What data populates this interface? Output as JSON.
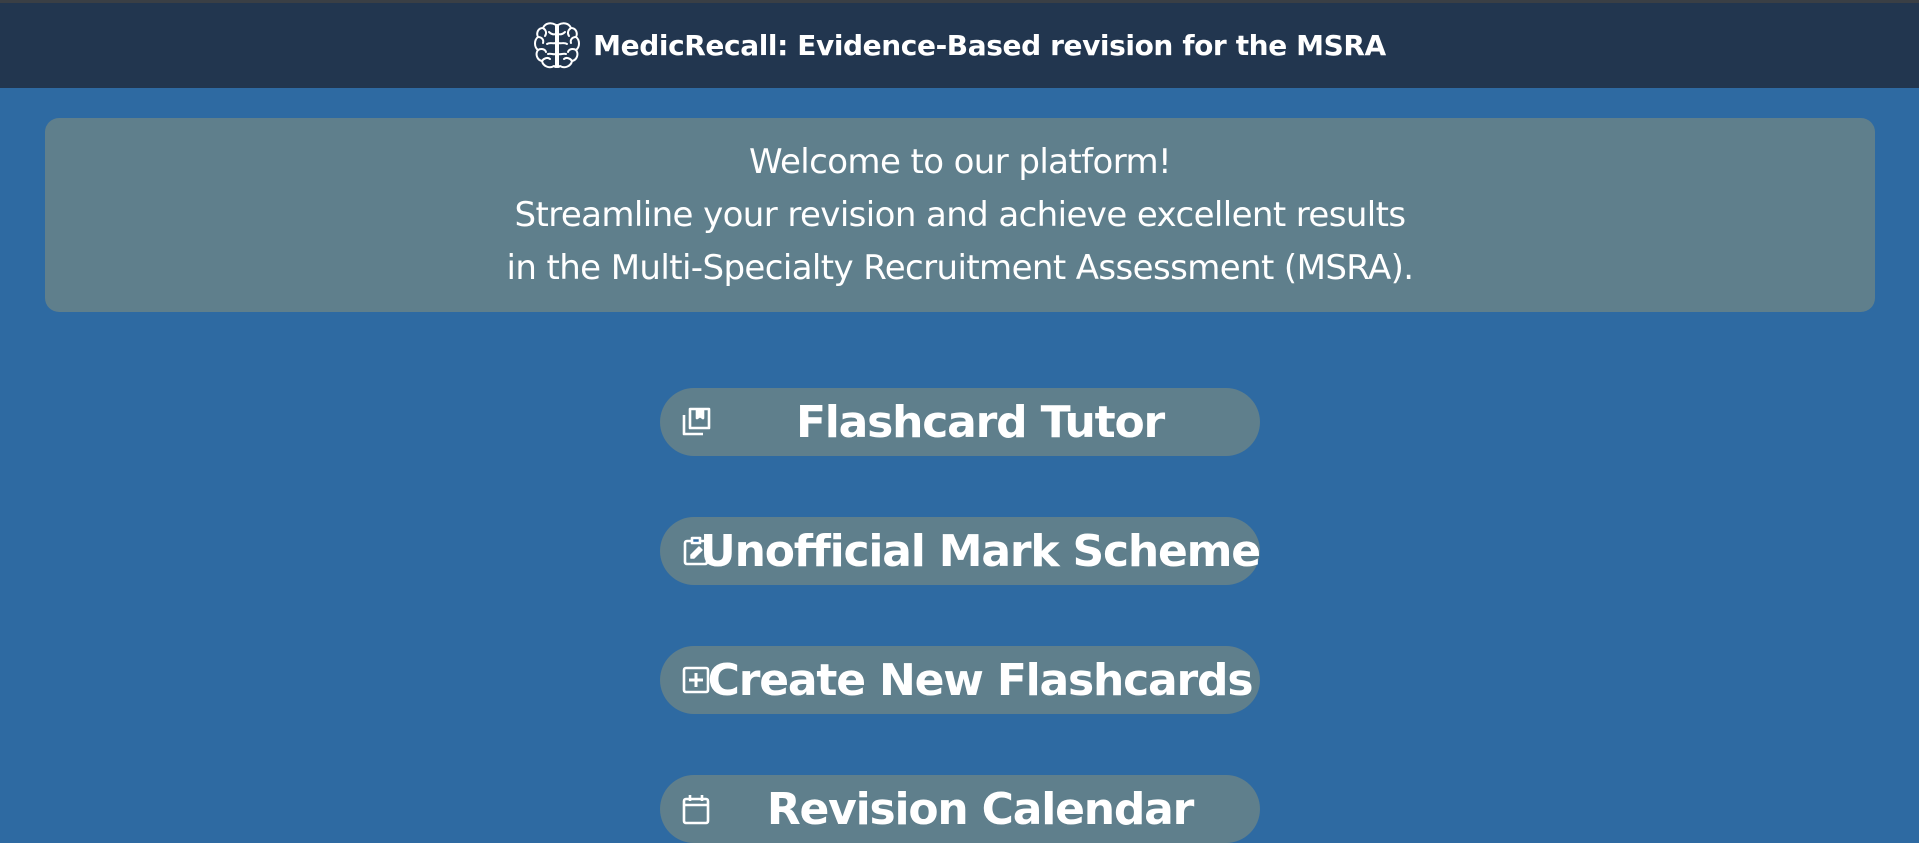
{
  "header": {
    "logo_icon": "brain-icon",
    "title": "MedicRecall: Evidence-Based revision for the MSRA"
  },
  "welcome": {
    "line1": "Welcome to our platform!",
    "line2": "Streamline your revision and achieve excellent results",
    "line3": "in the Multi-Specialty Recruitment Assessment (MSRA)."
  },
  "menu": {
    "items": [
      {
        "label": "Flashcard Tutor",
        "icon": "library-books-icon"
      },
      {
        "label": "Unofficial Mark Scheme",
        "icon": "clipboard-edit-icon"
      },
      {
        "label": "Create New Flashcards",
        "icon": "add-box-icon"
      },
      {
        "label": "Revision Calendar",
        "icon": "calendar-icon"
      }
    ]
  },
  "colors": {
    "background": "#2e6aa2",
    "header": "#22364f",
    "panel": "#5f7f8c",
    "text": "#ffffff"
  }
}
